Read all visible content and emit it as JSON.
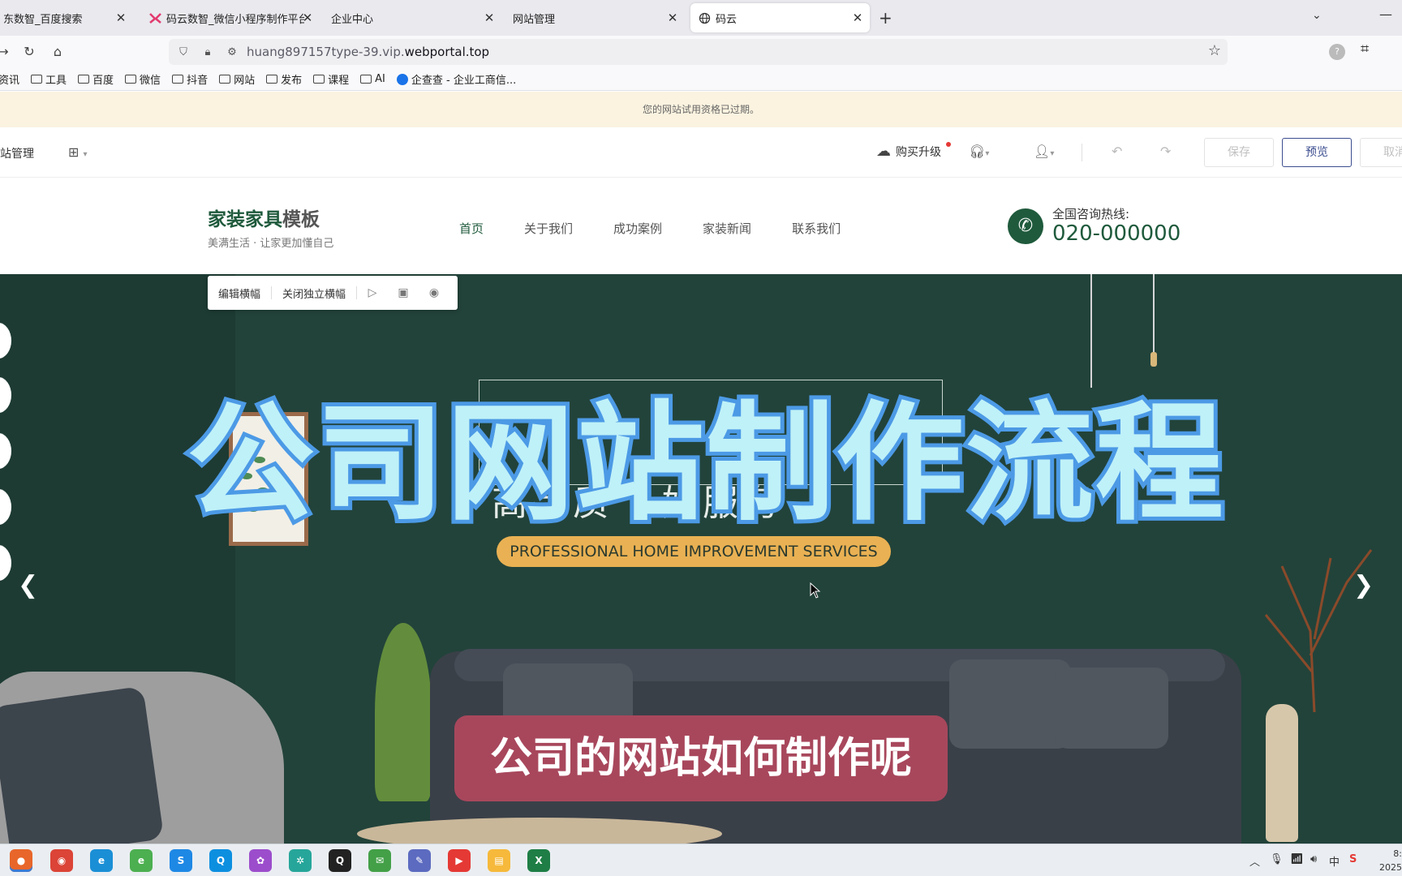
{
  "browser": {
    "tabs": [
      {
        "label": "东数智_百度搜索",
        "active": false
      },
      {
        "label": "码云数智_微信小程序制作平台_",
        "active": false
      },
      {
        "label": "企业中心",
        "active": false
      },
      {
        "label": "网站管理",
        "active": false
      },
      {
        "label": "码云",
        "active": true
      }
    ],
    "new_tab": "+",
    "url_prefix": "huang897157type-39.vip.",
    "url_domain": "webportal.top",
    "bookmarks": [
      "资讯",
      "工具",
      "百度",
      "微信",
      "抖音",
      "网站",
      "发布",
      "课程",
      "AI",
      "企查查 - 企业工商信..."
    ]
  },
  "notice": "您的网站试用资格已过期。",
  "editor": {
    "title": "站管理",
    "upgrade": "购买升级",
    "save": "保存",
    "preview": "预览",
    "cancel": "取消"
  },
  "site": {
    "logo_main_a": "家装家具",
    "logo_main_b": "模板",
    "logo_sub": "美满生活 · 让家更加懂自己",
    "nav": [
      "首页",
      "关于我们",
      "成功案例",
      "家装新闻",
      "联系我们"
    ],
    "hotline_label": "全国咨询热线:",
    "hotline_number": "020-000000"
  },
  "hero": {
    "slogan_partial": "高品质 · 好服务",
    "pill": "PROFESSIONAL HOME IMPROVEMENT SERVICES",
    "overlay_title": "公司网站制作流程",
    "subtitle": "公司的网站如何制作呢"
  },
  "float_toolbar": {
    "edit": "编辑横幅",
    "close_independent": "关闭独立横幅"
  },
  "clock": {
    "time": "8:",
    "date": "2025"
  },
  "tray": {
    "ime": "中"
  },
  "colors": {
    "brand_green": "#1f5a3c",
    "hero_bg": "#22433a",
    "pill": "#e9b153",
    "title_fill": "#bff1f8",
    "title_stroke": "#4c9ae6",
    "subtitle_bg": "#a8475c"
  }
}
